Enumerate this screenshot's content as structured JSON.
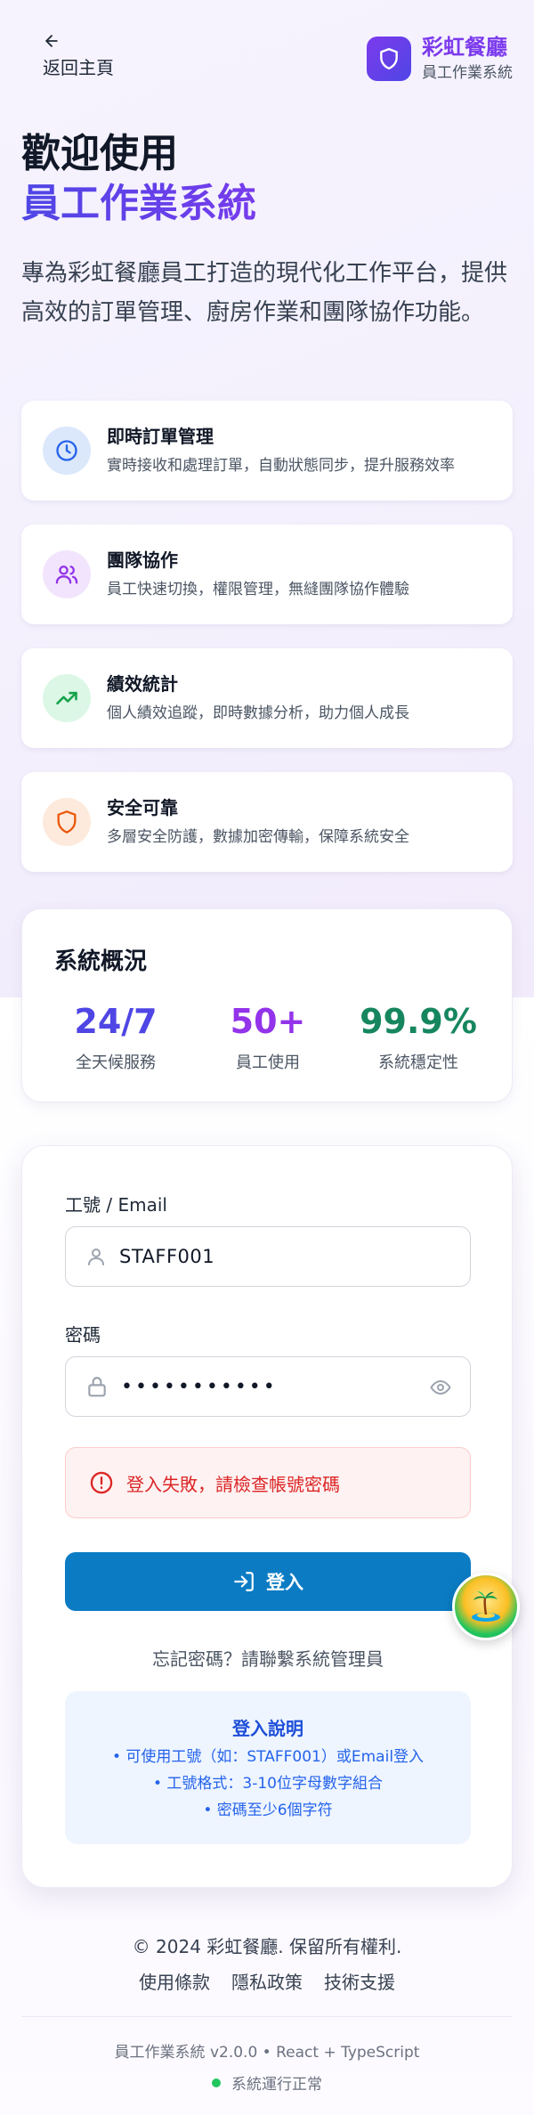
{
  "header": {
    "back_label": "返回主頁",
    "brand_name": "彩虹餐廳",
    "brand_sub": "員工作業系統"
  },
  "hero": {
    "title_line1": "歡迎使用",
    "title_line2": "員工作業系統",
    "description": "專為彩虹餐廳員工打造的現代化工作平台，提供高效的訂單管理、廚房作業和團隊協作功能。"
  },
  "features": [
    {
      "icon": "clock-icon",
      "title": "即時訂單管理",
      "desc": "實時接收和處理訂單，自動狀態同步，提升服務效率",
      "color": "#2563eb",
      "bg": "#dbe7fb"
    },
    {
      "icon": "users-icon",
      "title": "團隊協作",
      "desc": "員工快速切換，權限管理，無縫團隊協作體驗",
      "color": "#9333ea",
      "bg": "#f1e4fc"
    },
    {
      "icon": "trending-up-icon",
      "title": "績效統計",
      "desc": "個人績效追蹤，即時數據分析，助力個人成長",
      "color": "#16a34a",
      "bg": "#dcf7e6"
    },
    {
      "icon": "shield-icon",
      "title": "安全可靠",
      "desc": "多層安全防護，數據加密傳輸，保障系統安全",
      "color": "#ea580c",
      "bg": "#fdeadc"
    }
  ],
  "stats": {
    "title": "系統概況",
    "items": [
      {
        "value": "24/7",
        "label": "全天候服務",
        "color": "#4f46e5"
      },
      {
        "value": "50+",
        "label": "員工使用",
        "color": "#9333ea"
      },
      {
        "value": "99.9%",
        "label": "系統穩定性",
        "color": "#16865e"
      }
    ]
  },
  "login": {
    "id_label": "工號 / Email",
    "id_value": "STAFF001",
    "password_label": "密碼",
    "password_mask": "•••••••••••",
    "error": "登入失敗，請檢查帳號密碼",
    "submit": "登入",
    "forgot": "忘記密碼？請聯繫系統管理員",
    "help_title": "登入說明",
    "help_lines": [
      "• 可使用工號（如：STAFF001）或Email登入",
      "• 工號格式：3-10位字母數字組合",
      "• 密碼至少6個字符"
    ]
  },
  "footer": {
    "copyright": "© 2024 彩虹餐廳. 保留所有權利.",
    "links": [
      "使用條款",
      "隱私政策",
      "技術支援"
    ],
    "version": "員工作業系統 v2.0.0 • React + TypeScript",
    "status": "系統運行正常"
  },
  "colors": {
    "brand": "#7c3aed",
    "primary_button": "#0b7cc4",
    "error": "#dc2626",
    "status_ok": "#22c55e"
  }
}
